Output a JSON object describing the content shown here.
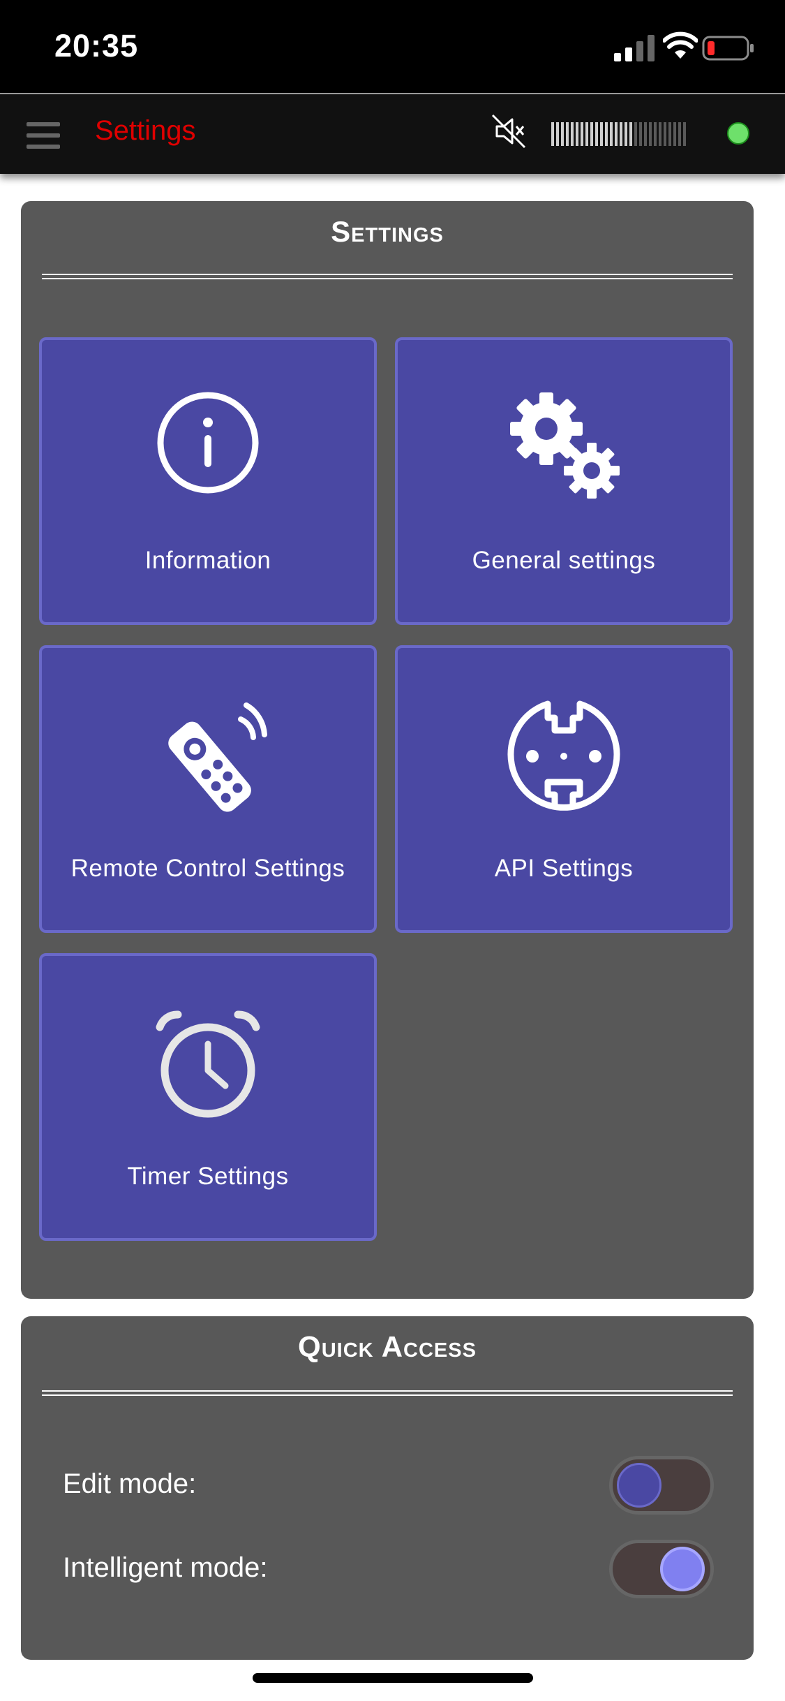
{
  "status_bar": {
    "time": "20:35"
  },
  "app_bar": {
    "title": "Settings",
    "connection_color": "#6ee06b",
    "level_active_fraction": 0.62
  },
  "settings_panel": {
    "title": "Settings",
    "tiles": [
      {
        "label": "Information",
        "icon": "info-icon"
      },
      {
        "label": "General settings",
        "icon": "gears-icon"
      },
      {
        "label": "Remote Control Settings",
        "icon": "remote-control-icon"
      },
      {
        "label": "API Settings",
        "icon": "api-plug-icon"
      },
      {
        "label": "Timer Settings",
        "icon": "alarm-clock-icon"
      }
    ]
  },
  "quick_access": {
    "title": "Quick Access",
    "edit_mode": {
      "label": "Edit mode:",
      "on": false
    },
    "intelligent_mode": {
      "label": "Intelligent mode:",
      "on": true
    }
  },
  "colors": {
    "accent": "#4a48a3",
    "title_red": "#e00000",
    "panel": "#585858"
  }
}
